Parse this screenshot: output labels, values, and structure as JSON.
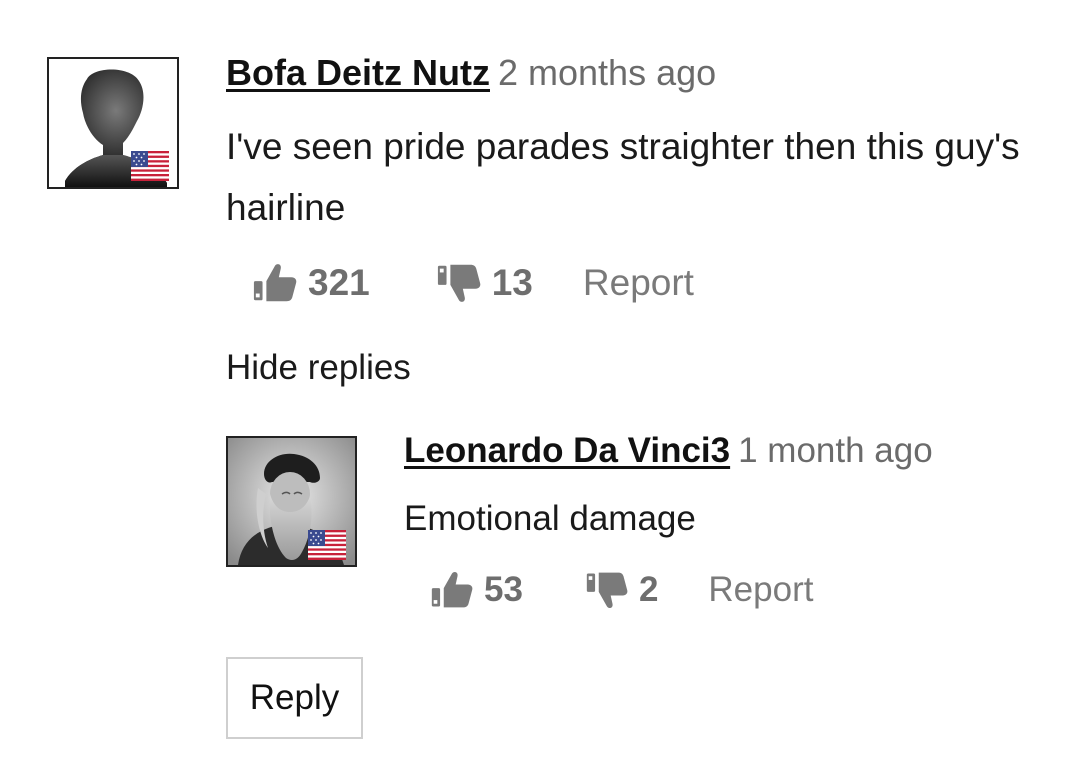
{
  "comment": {
    "username": "Bofa Deitz Nutz",
    "timestamp": "2 months ago",
    "text": "I've seen pride parades straighter then this guy's hairline",
    "likes": "321",
    "dislikes": "13",
    "report_label": "Report",
    "avatar_icon": "user-silhouette-icon",
    "flag_icon": "us-flag-icon"
  },
  "hide_replies_label": "Hide replies",
  "reply": {
    "username": "Leonardo Da Vinci3",
    "timestamp": "1 month ago",
    "text": "Emotional damage",
    "likes": "53",
    "dislikes": "2",
    "report_label": "Report",
    "avatar_icon": "portrait-avatar",
    "flag_icon": "us-flag-icon"
  },
  "reply_button_label": "Reply",
  "colors": {
    "text": "#111111",
    "muted": "#6b6b6b",
    "icon": "#7a7a7a",
    "border": "#cfcfcf"
  }
}
